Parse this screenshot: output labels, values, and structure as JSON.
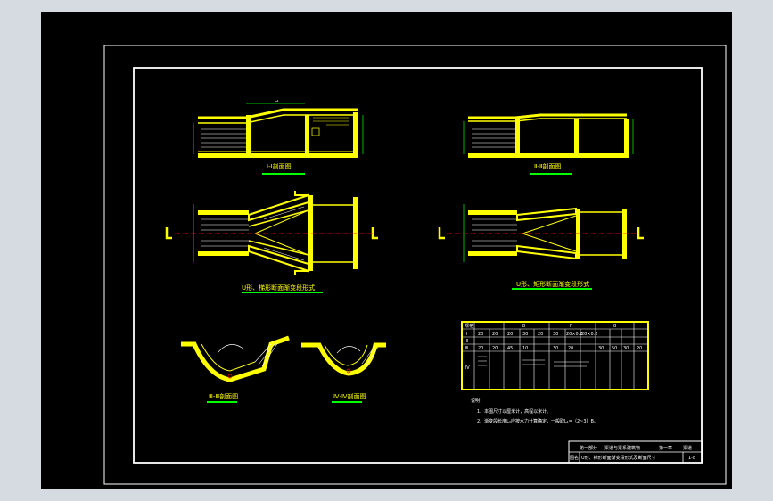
{
  "colors": {
    "background": "#000000",
    "frame": "#ffffff",
    "structure": "#ffff00",
    "dimension": "#00ff00",
    "centerline": "#ff0000",
    "text": "#ffffff"
  },
  "views": {
    "section_1": {
      "title": "Ⅰ-Ⅰ剖面图",
      "dim_top": "L₁"
    },
    "section_2": {
      "title": "Ⅱ-Ⅱ剖面图"
    },
    "plan_1": {
      "title": "U形、梯形断面渐变段形式"
    },
    "plan_2": {
      "title": "U形、矩形断面渐变段形式"
    },
    "section_3": {
      "title": "Ⅲ-Ⅲ剖面图"
    },
    "section_4": {
      "title": "Ⅳ-Ⅳ剖面图"
    }
  },
  "table": {
    "header": [
      "规格",
      "b",
      "h",
      "α"
    ],
    "rows": [
      [
        "Ⅰ",
        "20",
        "20",
        "20",
        "30",
        "20",
        "30",
        "20×0.2",
        "20×0.2",
        "",
        "",
        "",
        ""
      ],
      [
        "Ⅱ",
        "",
        "",
        "",
        "",
        "",
        "",
        "",
        "",
        "",
        "",
        "",
        ""
      ],
      [
        "Ⅲ",
        "20",
        "20",
        "45",
        "10",
        "",
        "30",
        "20",
        "",
        "30",
        "50",
        "30",
        "20"
      ],
      [
        "Ⅳ",
        "",
        "",
        "",
        "",
        "",
        "",
        "",
        "",
        "",
        "",
        "",
        ""
      ]
    ]
  },
  "notes": {
    "heading": "说明：",
    "line1": "1、本图尺寸以厘米计，高程以米计。",
    "line2": "2、渐变段长度L₁应按水力计算确定，一般取L₁=（2~3）B。"
  },
  "title_block": {
    "row1_a": "第一部分",
    "row1_b": "渠道与渠系建筑物",
    "row1_c": "第一章",
    "row1_d": "渠道",
    "row2_a": "图名",
    "row2_b": "U形、梯形断面渐变段形式及断面尺寸",
    "row2_c": "1-8"
  }
}
